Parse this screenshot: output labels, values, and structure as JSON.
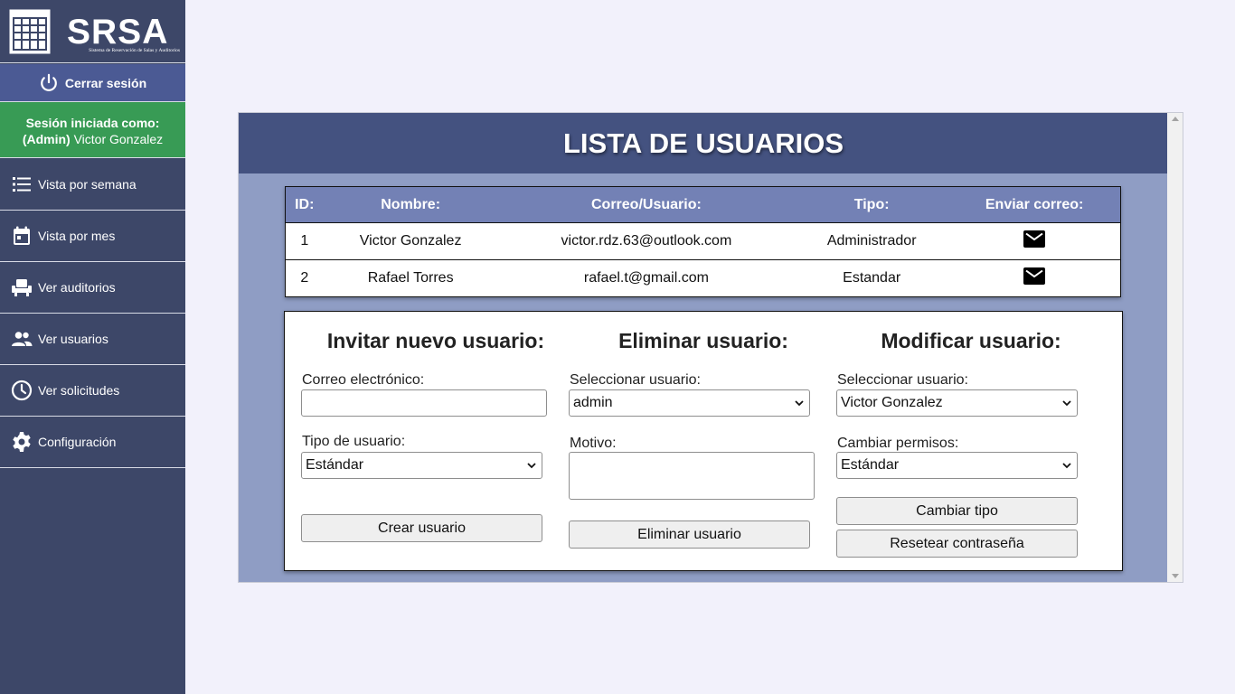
{
  "brand": {
    "name": "SRSA",
    "tagline": "Sistema de Reservación de Salas y Auditorios"
  },
  "sidebar": {
    "logout_label": "Cerrar sesión",
    "session_label": "Sesión iniciada como:",
    "session_role": "(Admin)",
    "session_user": "Victor Gonzalez",
    "items": [
      {
        "label": "Vista por semana",
        "icon": "list-icon"
      },
      {
        "label": "Vista por mes",
        "icon": "calendar-icon"
      },
      {
        "label": "Ver auditorios",
        "icon": "seat-icon"
      },
      {
        "label": "Ver usuarios",
        "icon": "users-icon"
      },
      {
        "label": "Ver solicitudes",
        "icon": "clock-icon"
      },
      {
        "label": "Configuración",
        "icon": "gear-icon"
      }
    ]
  },
  "main": {
    "title": "LISTA DE USUARIOS",
    "table": {
      "headers": [
        "ID:",
        "Nombre:",
        "Correo/Usuario:",
        "Tipo:",
        "Enviar correo:"
      ],
      "rows": [
        {
          "id": "1",
          "name": "Victor Gonzalez",
          "email": "victor.rdz.63@outlook.com",
          "type": "Administrador"
        },
        {
          "id": "2",
          "name": "Rafael Torres",
          "email": "rafael.t@gmail.com",
          "type": "Estandar"
        }
      ]
    },
    "invite": {
      "title": "Invitar nuevo usuario:",
      "email_label": "Correo electrónico:",
      "email_value": "",
      "type_label": "Tipo de usuario:",
      "type_value": "Estándar",
      "button": "Crear usuario"
    },
    "delete": {
      "title": "Eliminar usuario:",
      "select_label": "Seleccionar usuario:",
      "select_value": "admin",
      "reason_label": "Motivo:",
      "reason_value": "",
      "button": "Eliminar usuario"
    },
    "modify": {
      "title": "Modificar usuario:",
      "select_label": "Seleccionar usuario:",
      "select_value": "Victor Gonzalez",
      "perm_label": "Cambiar permisos:",
      "perm_value": "Estándar",
      "button_change": "Cambiar tipo",
      "button_reset": "Resetear contraseña"
    }
  },
  "colors": {
    "sidebar": "#3d4768",
    "logout": "#4b5a94",
    "session": "#389b55",
    "header": "#445280",
    "table_header": "#7381b5",
    "panel": "#8f9dc4"
  }
}
